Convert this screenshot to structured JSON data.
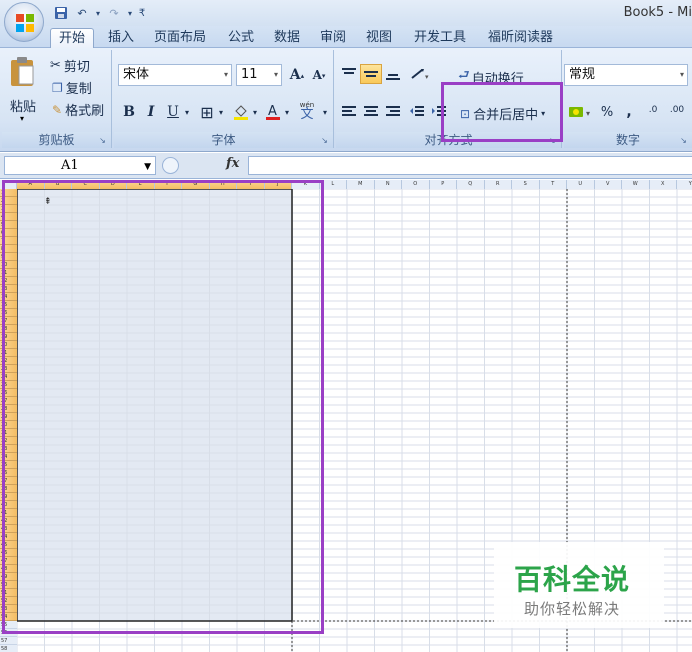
{
  "window": {
    "title": "Book5 - Mi"
  },
  "tabs": [
    {
      "label": "开始",
      "active": true
    },
    {
      "label": "插入"
    },
    {
      "label": "页面布局"
    },
    {
      "label": "公式"
    },
    {
      "label": "数据"
    },
    {
      "label": "审阅"
    },
    {
      "label": "视图"
    },
    {
      "label": "开发工具"
    },
    {
      "label": "福昕阅读器"
    }
  ],
  "clipboard": {
    "paste": "粘贴",
    "cut": "剪切",
    "copy": "复制",
    "format_painter": "格式刷",
    "label": "剪贴板"
  },
  "font": {
    "name": "宋体",
    "size": "11",
    "bold": "B",
    "italic": "I",
    "underline": "U",
    "grow": "A",
    "shrink": "A",
    "phonetic": "wén",
    "phonetic_char": "文",
    "label": "字体",
    "font_color": "#e02020"
  },
  "alignment": {
    "wrap_text": "自动换行",
    "merge_center": "合并后居中",
    "label": "对齐方式"
  },
  "number": {
    "format": "常规",
    "percent": "%",
    "comma": ",",
    "inc_decimal": ".0",
    "dec_decimal": ".00",
    "label": "数字"
  },
  "formula_bar": {
    "name_box": "A1",
    "fx": "fx"
  },
  "sheet": {
    "columns": [
      "A",
      "B",
      "C",
      "D",
      "E",
      "F",
      "G",
      "H",
      "I",
      "J",
      "K",
      "L",
      "M",
      "N",
      "O",
      "P",
      "Q",
      "R",
      "S",
      "T",
      "U",
      "V",
      "W",
      "X",
      "Y"
    ],
    "selected_columns": [
      "A",
      "B",
      "C",
      "D",
      "E",
      "F",
      "G",
      "H",
      "I",
      "J"
    ],
    "visible_rows": 58,
    "selected_rows": 54
  },
  "watermark": {
    "title": "百科全说",
    "subtitle": "助你轻松解决"
  },
  "colors": {
    "highlight": "#9a3fc5",
    "selection": "#e3e9f3",
    "header_selected": "#f4bd63"
  }
}
